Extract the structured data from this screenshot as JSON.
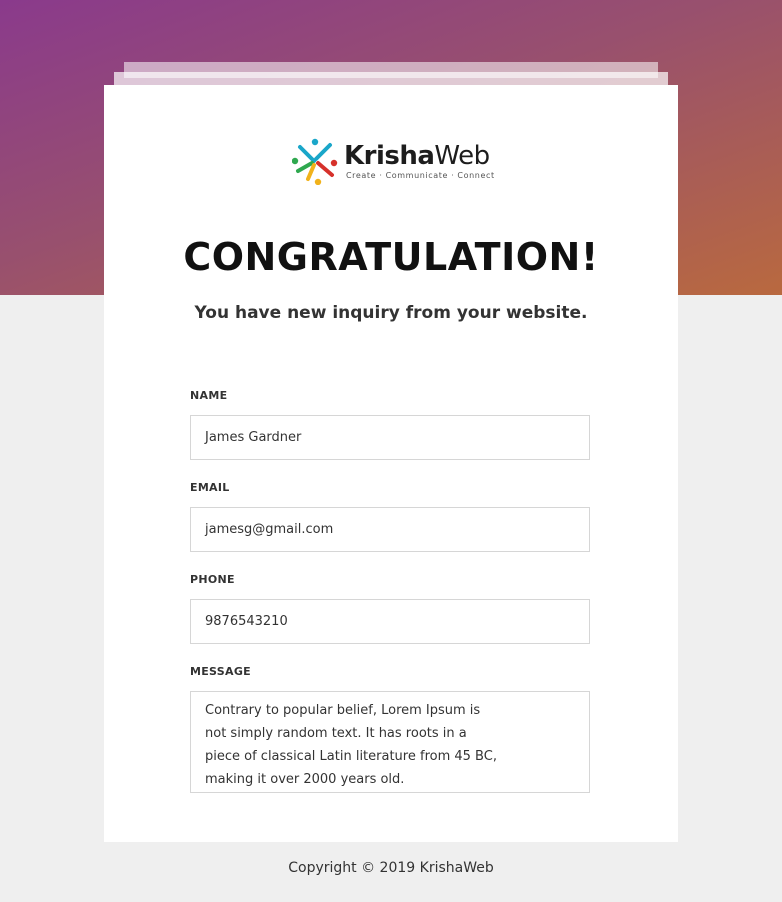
{
  "brand": {
    "name_bold": "Krisha",
    "name_regular": "Web",
    "tagline": "Create · Communicate · Connect"
  },
  "heading": {
    "title": "CONGRATULATION!",
    "subtitle": "You have new inquiry from your website."
  },
  "form": {
    "name_label": "NAME",
    "name_value": "James Gardner",
    "email_label": "EMAIL",
    "email_value": "jamesg@gmail.com",
    "phone_label": "PHONE",
    "phone_value": "9876543210",
    "message_label": "MESSAGE",
    "message_lines": [
      "Contrary to popular belief, Lorem Ipsum is",
      "not simply random text. It has roots in a",
      "piece of classical Latin literature from 45 BC,",
      "making it over 2000 years old."
    ]
  },
  "footer": {
    "copyright": "Copyright © 2019 KrishaWeb"
  },
  "colors": {
    "gradient_start": "#8a3a8c",
    "gradient_end": "#b9693f",
    "page_background": "#efefef",
    "card_background": "#ffffff"
  }
}
